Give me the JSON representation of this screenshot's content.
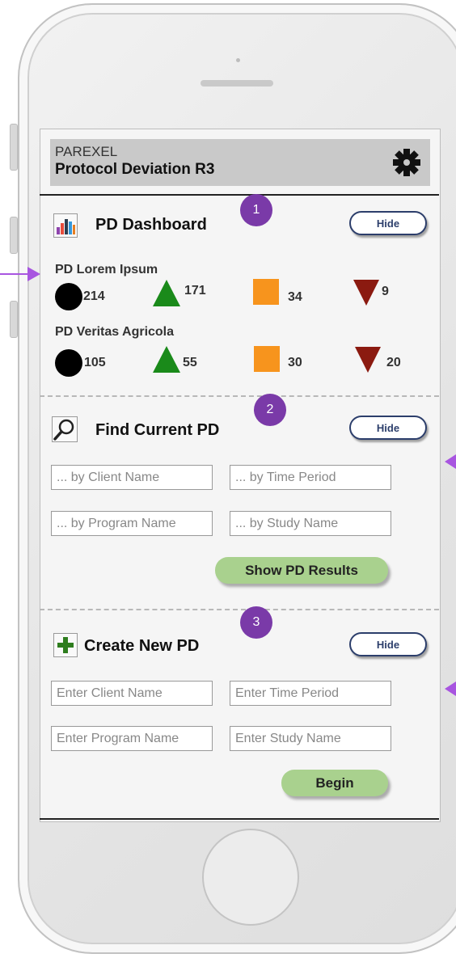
{
  "header": {
    "brand": "PAREXEL",
    "title": "Protocol Deviation R3",
    "settings_icon": "gear-icon"
  },
  "colors": {
    "accent_purple": "#7a3aa8",
    "button_green": "#a9d18e",
    "hide_border": "#2c3e6b",
    "stat_orange": "#f7941d",
    "stat_green": "#1a8a1a",
    "stat_red": "#8b1a10"
  },
  "dashboard": {
    "badge": "1",
    "title": "PD Dashboard",
    "icon": "bar-chart-icon",
    "hide_label": "Hide",
    "groups": [
      {
        "label": "PD Lorem Ipsum",
        "black": "214",
        "green": "171",
        "orange": "34",
        "red": "9"
      },
      {
        "label": "PD Veritas Agricola",
        "black": "105",
        "green": "55",
        "orange": "30",
        "red": "20"
      }
    ]
  },
  "find": {
    "badge": "2",
    "title": "Find Current PD",
    "icon": "magnifier-icon",
    "hide_label": "Hide",
    "client_placeholder": "... by Client Name",
    "time_placeholder": "... by Time Period",
    "program_placeholder": "... by Program Name",
    "study_placeholder": "... by Study Name",
    "submit_label": "Show PD Results"
  },
  "create": {
    "badge": "3",
    "title": "Create New PD",
    "icon": "plus-icon",
    "hide_label": "Hide",
    "client_placeholder": "Enter Client Name",
    "time_placeholder": "Enter Time Period",
    "program_placeholder": "Enter Program Name",
    "study_placeholder": "Enter Study Name",
    "submit_label": "Begin"
  }
}
